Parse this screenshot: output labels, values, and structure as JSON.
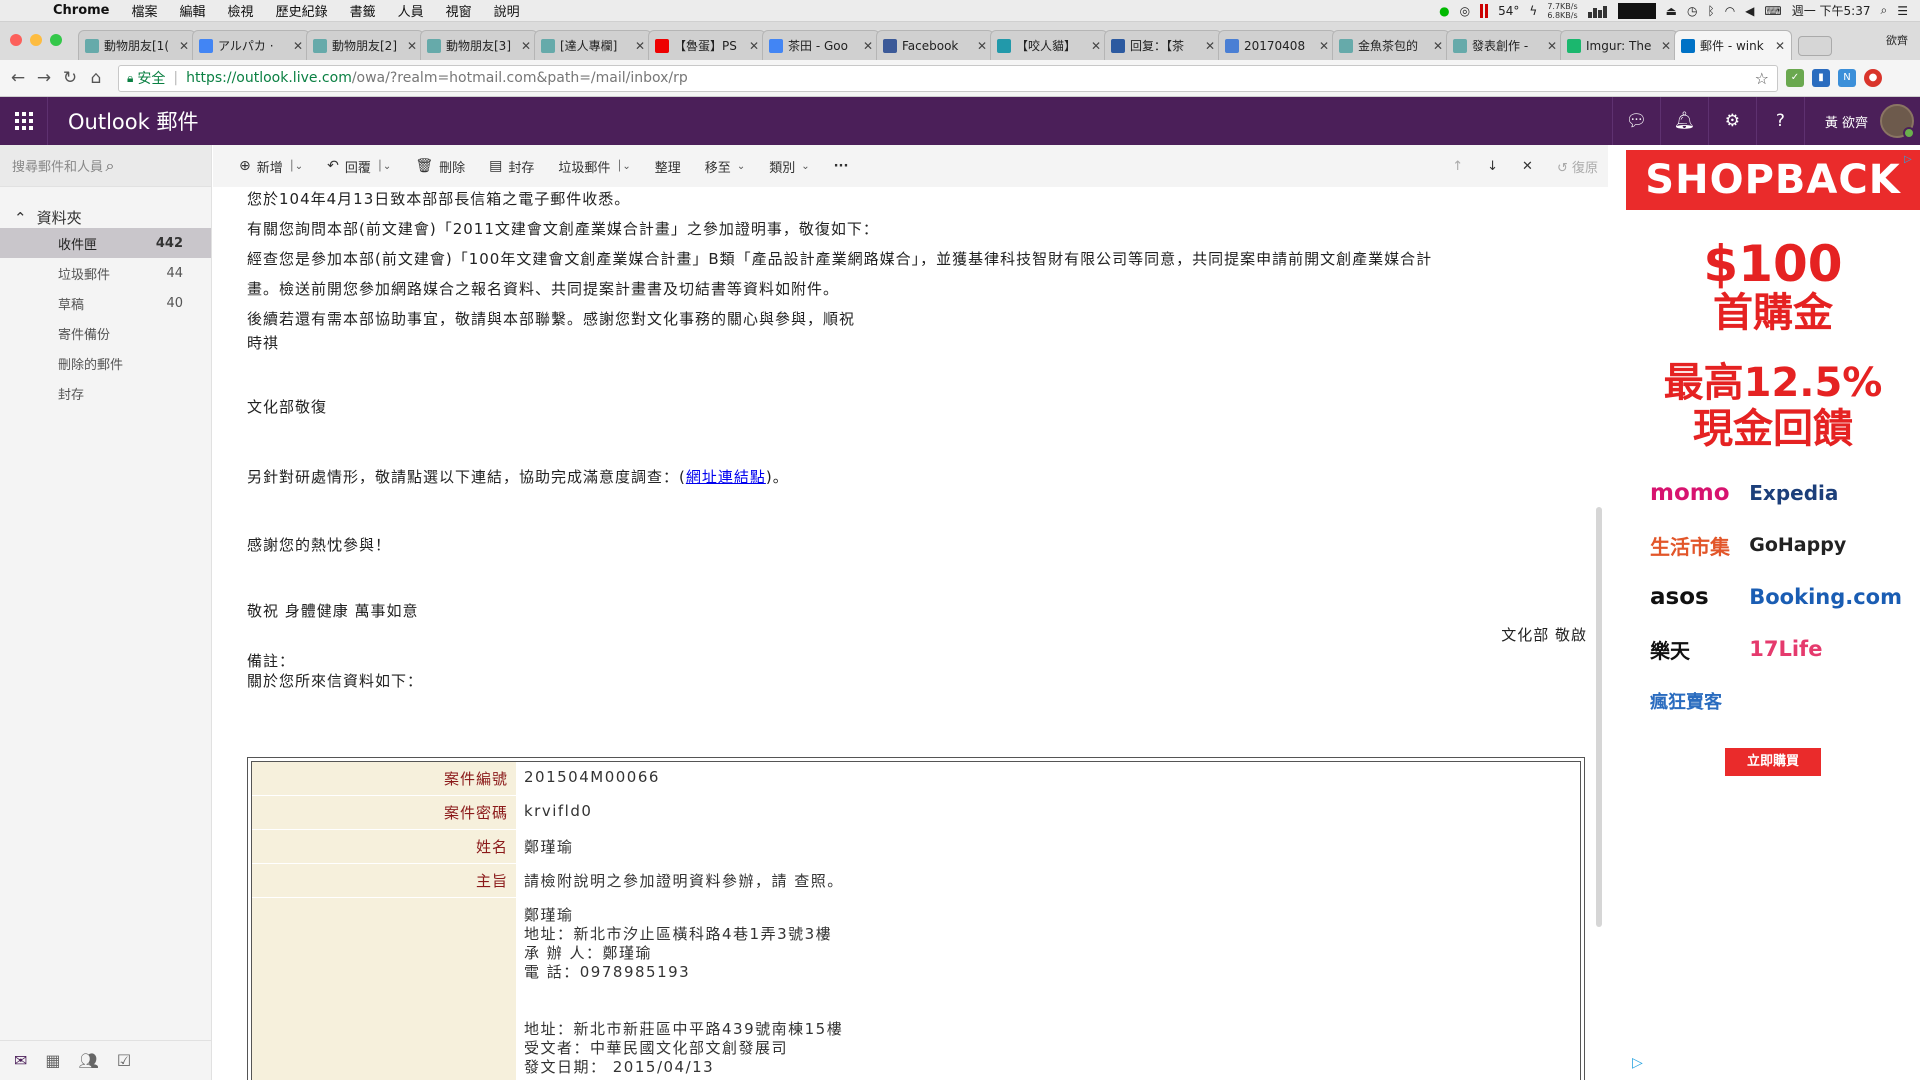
{
  "menubar": {
    "app": "Chrome",
    "menus": [
      "檔案",
      "編輯",
      "檢視",
      "歷史紀錄",
      "書籤",
      "人員",
      "視窗",
      "說明"
    ],
    "temperature": "54°",
    "net_up": "7.7KB/s",
    "net_down": "6.8KB/s",
    "datetime": "週一 下午5:37"
  },
  "tabs": [
    {
      "title": "動物朋友[1(",
      "icon": "bird-icon",
      "color": "#6aa"
    },
    {
      "title": "アルパカ ·",
      "icon": "google-icon",
      "color": "#4285f4"
    },
    {
      "title": "動物朋友[2]",
      "icon": "bird-icon",
      "color": "#6aa"
    },
    {
      "title": "動物朋友[3]",
      "icon": "bird-icon",
      "color": "#6aa"
    },
    {
      "title": "[達人專欄]",
      "icon": "bird-icon",
      "color": "#6aa"
    },
    {
      "title": "【魯蛋】PS",
      "icon": "youtube-icon",
      "color": "#e00"
    },
    {
      "title": "茶田 - Goo",
      "icon": "google-icon",
      "color": "#4285f4"
    },
    {
      "title": "Facebook",
      "icon": "facebook-icon",
      "color": "#3b5998"
    },
    {
      "title": "【咬人貓】",
      "icon": "tv-icon",
      "color": "#29a"
    },
    {
      "title": "回复：【茶",
      "icon": "paw-icon",
      "color": "#2c5aa0"
    },
    {
      "title": "20170408",
      "icon": "cloud-icon",
      "color": "#4a7fd4"
    },
    {
      "title": "金魚茶包的",
      "icon": "bird-icon",
      "color": "#6aa"
    },
    {
      "title": "發表創作 -",
      "icon": "bird-icon",
      "color": "#6aa"
    },
    {
      "title": "Imgur: The",
      "icon": "imgur-icon",
      "color": "#1bb76e"
    },
    {
      "title": "郵件 - wink",
      "icon": "outlook-icon",
      "color": "#0072c6",
      "active": true
    }
  ],
  "profile_name": "欲齊",
  "address": {
    "secure_label": "安全",
    "url_host": "https://outlook.live.com",
    "url_rest": "/owa/?realm=hotmail.com&path=/mail/inbox/rp"
  },
  "header": {
    "app_title": "Outlook 郵件",
    "user_name": "黃 欲齊"
  },
  "search": {
    "placeholder": "搜尋郵件和人員"
  },
  "folders": {
    "header": "資料夾",
    "items": [
      {
        "label": "收件匣",
        "count": "442",
        "active": true
      },
      {
        "label": "垃圾郵件",
        "count": "44"
      },
      {
        "label": "草稿",
        "count": "40"
      },
      {
        "label": "寄件備份",
        "count": ""
      },
      {
        "label": "刪除的郵件",
        "count": ""
      },
      {
        "label": "封存",
        "count": ""
      }
    ]
  },
  "toolbar": {
    "new": "新增",
    "reply": "回覆",
    "delete": "刪除",
    "archive": "封存",
    "junk": "垃圾郵件",
    "sweep": "整理",
    "move": "移至",
    "categories": "類別",
    "more": "···",
    "undo": "復原"
  },
  "email": {
    "p1": "您於104年4月13日致本部部長信箱之電子郵件收悉。",
    "p2": "有關您詢問本部(前文建會)「2011文建會文創產業媒合計畫」之參加證明事，敬復如下：",
    "p3a": "經查您是參加本部(前文建會)「100年文建會文創產業媒合計畫」B類「產品設計產業網路媒合」，並獲基律科技智財有限公司等同意，共同提案申請前開文創產業媒合計",
    "p3b": "畫。檢送前開您參加網路媒合之報名資料、共同提案計畫書及切結書等資料如附件。",
    "p4": "後續若還有需本部協助事宜，敬請與本部聯繫。感謝您對文化事務的關心與參與，順祝",
    "p5": "時祺",
    "sign1": "文化部敬復",
    "survey_pre": "另針對研處情形，敬請點選以下連結，協助完成滿意度調查：(",
    "survey_link": "網址連結點",
    "survey_post": ")。",
    "thanks": "感謝您的熱忱參與！",
    "regards": "敬祝 身體健康 萬事如意",
    "sign2": "文化部 敬啟",
    "note1": "備註：",
    "note2": "關於您所來信資料如下："
  },
  "case": {
    "id_label": "案件編號",
    "id_value": "201504M00066",
    "pw_label": "案件密碼",
    "pw_value": "krvifld0",
    "name_label": "姓名",
    "name_value": "鄭瑾瑜",
    "subject_label": "主旨",
    "subject_value": "請檢附說明之參加證明資料參辦，請 查照。",
    "detail_lines": [
      "鄭瑾瑜",
      "地址：新北市汐止區橫科路4巷1弄3號3樓",
      "承 辦 人：鄭瑾瑜",
      "電 話：0978985193",
      "",
      "",
      "地址：新北市新莊區中平路439號南棟15樓",
      "受文者：中華民國文化部文創發展司",
      "發文日期： 2015/04/13"
    ]
  },
  "ad": {
    "brand": "SHOPBACK",
    "amount": "$100",
    "line1": "首購金",
    "line2": "最高12.5%",
    "line3": "現金回饋",
    "partners": [
      "momo",
      "Expedia",
      "生活市集",
      "GoHappy",
      "asos",
      "Booking.com",
      "樂天",
      "17Life",
      "瘋狂賣客"
    ],
    "cta": "立即購買",
    "accent": "#ea2b2b"
  },
  "colors": {
    "outlook_purple": "#4b1f59"
  }
}
